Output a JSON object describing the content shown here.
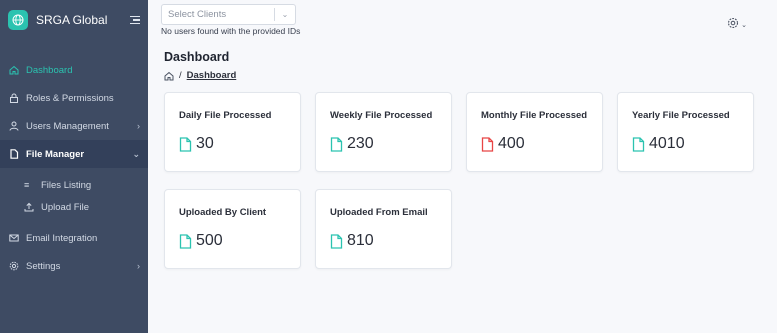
{
  "brand": {
    "name": "SRGA Global"
  },
  "sidebar": {
    "items": [
      {
        "label": "Dashboard"
      },
      {
        "label": "Roles & Permissions"
      },
      {
        "label": "Users Management"
      },
      {
        "label": "File Manager"
      },
      {
        "label": "Email Integration"
      },
      {
        "label": "Settings"
      }
    ],
    "file_manager_sub": [
      {
        "label": "Files Listing"
      },
      {
        "label": "Upload File"
      }
    ]
  },
  "topbar": {
    "select_placeholder": "Select Clients",
    "helper_text": "No users found with the provided IDs"
  },
  "page": {
    "title": "Dashboard",
    "breadcrumb": "Dashboard"
  },
  "cards": [
    {
      "title": "Daily File Processed",
      "value": "30",
      "icon": "file-icon",
      "color": "#2bc3b0"
    },
    {
      "title": "Weekly File Processed",
      "value": "230",
      "icon": "file-icon",
      "color": "#2bc3b0"
    },
    {
      "title": "Monthly File Processed",
      "value": "400",
      "icon": "file-icon",
      "color": "#e84545"
    },
    {
      "title": "Yearly File Processed",
      "value": "4010",
      "icon": "file-icon",
      "color": "#2bc3b0"
    },
    {
      "title": "Uploaded By Client",
      "value": "500",
      "icon": "file-icon",
      "color": "#2bc3b0"
    },
    {
      "title": "Uploaded From Email",
      "value": "810",
      "icon": "file-icon",
      "color": "#2bc3b0"
    }
  ],
  "colors": {
    "accent": "#2bc3b0",
    "sidebar_bg": "#3e4b63",
    "alert": "#e84545"
  }
}
